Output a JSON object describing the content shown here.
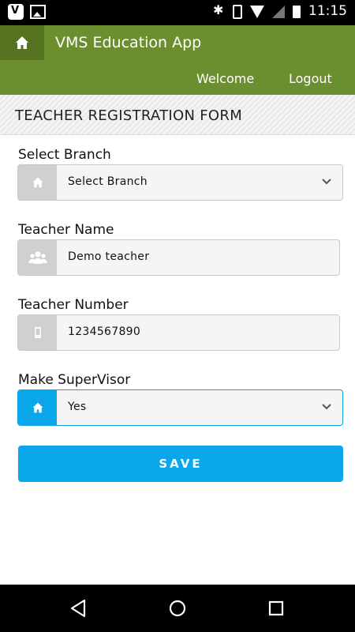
{
  "status_bar": {
    "time": "11:15",
    "icons": [
      "app-icon",
      "image-icon",
      "bluetooth-icon",
      "vibrate-icon",
      "wifi-icon",
      "cellular-icon",
      "battery-icon"
    ]
  },
  "header": {
    "title": "VMS Education App",
    "nav": {
      "welcome": "Welcome",
      "logout": "Logout"
    },
    "home_icon": "home-icon"
  },
  "section": {
    "title": "TEACHER REGISTRATION FORM"
  },
  "form": {
    "branch": {
      "label": "Select Branch",
      "value": "Select Branch",
      "icon": "home-icon"
    },
    "teacher_name": {
      "label": "Teacher Name",
      "value": "Demo teacher",
      "icon": "users-icon"
    },
    "teacher_number": {
      "label": "Teacher Number",
      "value": "1234567890",
      "icon": "mobile-icon"
    },
    "supervisor": {
      "label": "Make SuperVisor",
      "value": "Yes",
      "icon": "home-icon"
    },
    "save_label": "SAVE"
  },
  "colors": {
    "header_bg": "#6b8e2f",
    "home_btn_bg": "#56741f",
    "accent": "#0aa7ea",
    "addon_bg": "#d0d0d0"
  },
  "system_nav": {
    "icons": [
      "back-icon",
      "home-circle-icon",
      "recents-icon"
    ]
  }
}
